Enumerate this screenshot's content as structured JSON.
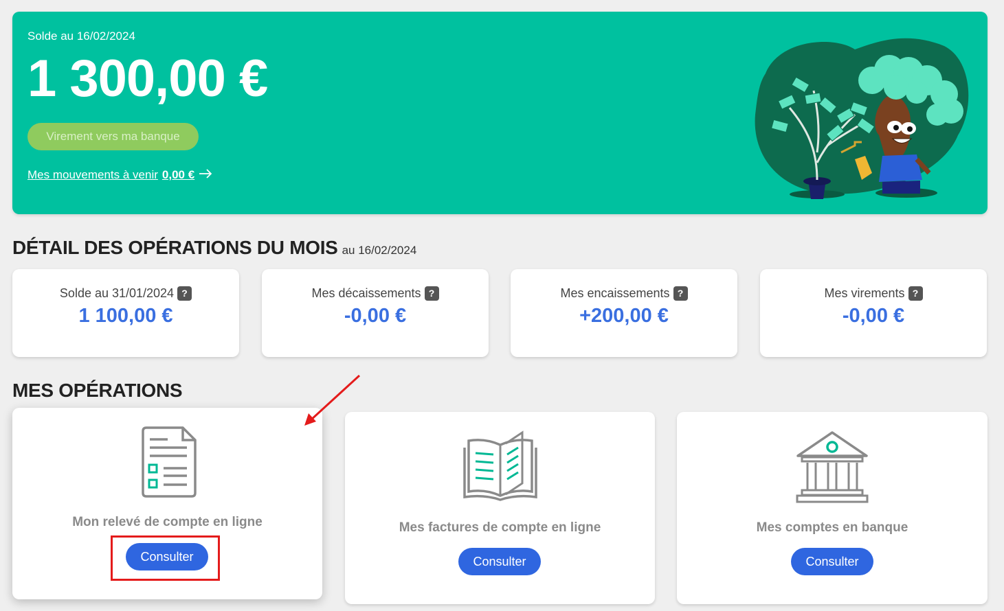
{
  "hero": {
    "date_label": "Solde au 16/02/2024",
    "amount": "1 300,00 €",
    "transfer_button": "Virement vers ma banque",
    "upcoming_label": "Mes mouvements à venir",
    "upcoming_amount": "0,00 €",
    "bg_color": "#00c19f"
  },
  "detail": {
    "title": "DÉTAIL DES OPÉRATIONS DU MOIS",
    "subtitle": "au 16/02/2024",
    "cards": [
      {
        "label": "Solde au 31/01/2024",
        "value": "1 100,00 €"
      },
      {
        "label": "Mes décaissements",
        "value": "-0,00 €"
      },
      {
        "label": "Mes encaissements",
        "value": "+200,00 €"
      },
      {
        "label": "Mes virements",
        "value": "-0,00 €"
      }
    ],
    "help_glyph": "?"
  },
  "operations": {
    "title": "MES OPÉRATIONS",
    "cards": [
      {
        "label": "Mon relevé de compte en ligne",
        "button": "Consulter",
        "icon": "document-list-icon"
      },
      {
        "label": "Mes factures de compte en ligne",
        "button": "Consulter",
        "icon": "open-book-icon"
      },
      {
        "label": "Mes comptes en banque",
        "button": "Consulter",
        "icon": "bank-icon"
      }
    ]
  },
  "colors": {
    "accent_blue": "#2f66e0",
    "value_blue": "#3a6fe0",
    "annotation_red": "#e41b1b"
  }
}
